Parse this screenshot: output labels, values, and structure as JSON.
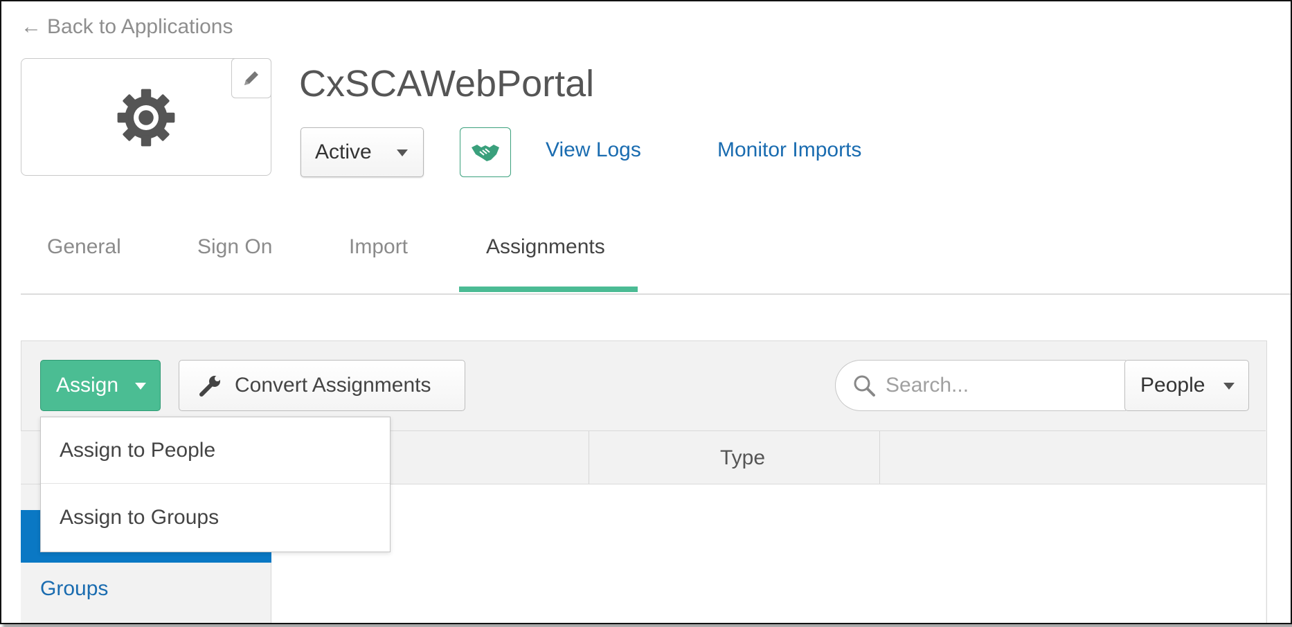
{
  "nav": {
    "back_arrow": "←",
    "back_label": "Back to Applications"
  },
  "app": {
    "title": "CxSCAWebPortal",
    "logo_icon": "gear-icon",
    "edit_icon": "pencil-icon"
  },
  "status": {
    "selected": "Active"
  },
  "actions": {
    "provision_icon": "handshake-icon",
    "view_logs": "View Logs",
    "monitor_imports": "Monitor Imports"
  },
  "tabs": [
    {
      "label": "General"
    },
    {
      "label": "Sign On"
    },
    {
      "label": "Import"
    },
    {
      "label": "Assignments",
      "active": true
    }
  ],
  "toolbar": {
    "assign_label": "Assign",
    "convert_label": "Convert Assignments",
    "convert_icon": "wrench-icon",
    "search_placeholder": "Search...",
    "filter_selected": "People"
  },
  "assign_menu": {
    "items": [
      {
        "label": "Assign to People"
      },
      {
        "label": "Assign to Groups"
      }
    ]
  },
  "table": {
    "columns": [
      {
        "label": ""
      },
      {
        "label": "Type"
      },
      {
        "label": ""
      }
    ]
  },
  "sidebar": {
    "items": [
      {
        "label": "",
        "active": true
      },
      {
        "label": "Groups"
      }
    ]
  },
  "colors": {
    "accent": "#4bbd93",
    "link": "#1a6cb0",
    "sidebar_active": "#0a78c4"
  }
}
